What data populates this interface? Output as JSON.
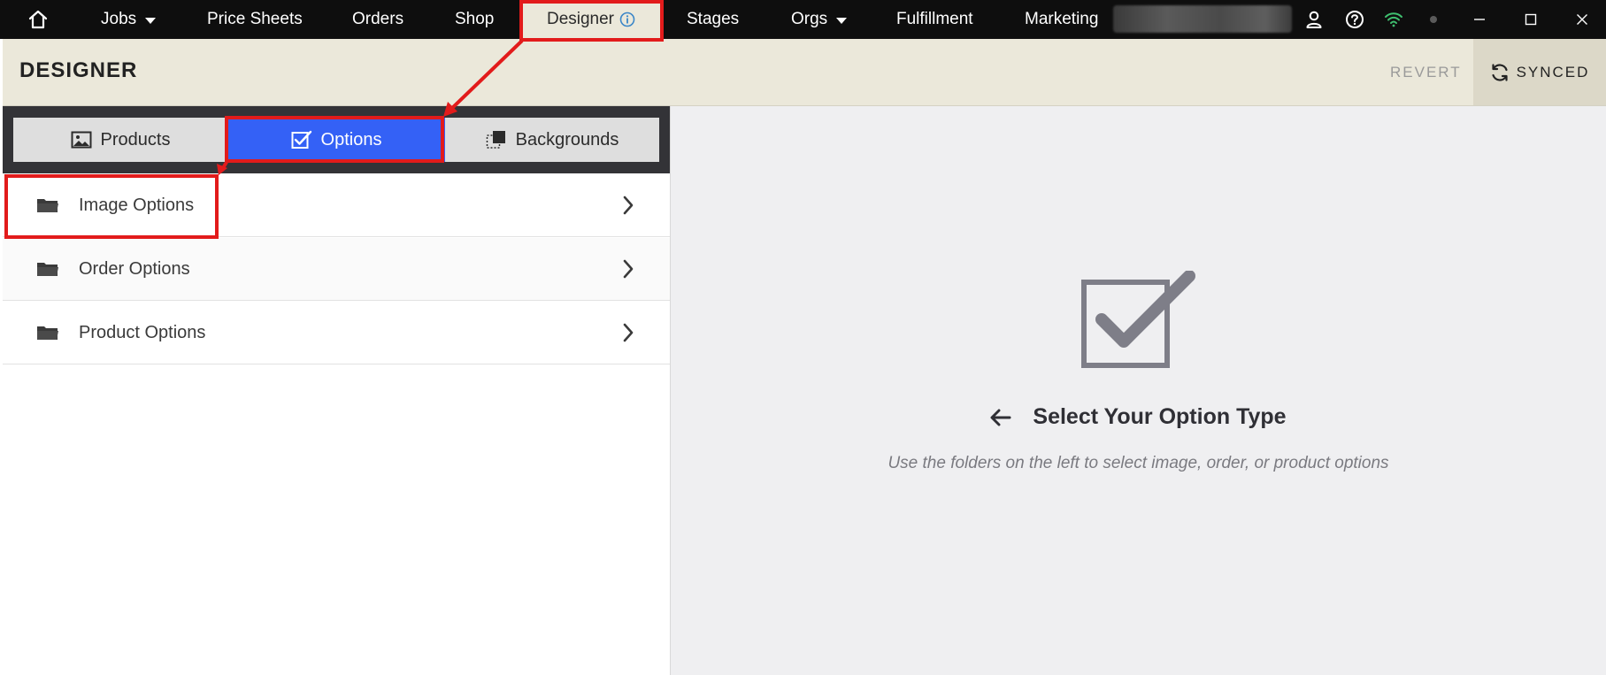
{
  "nav": {
    "home_icon": "home-icon",
    "jobs": "Jobs",
    "price_sheets": "Price Sheets",
    "orders": "Orders",
    "shop": "Shop",
    "designer": "Designer",
    "stages": "Stages",
    "orgs": "Orgs",
    "fulfillment": "Fulfillment",
    "marketing": "Marketing"
  },
  "window_controls": [
    "user-icon",
    "help-icon",
    "wifi-icon",
    "status-dot-icon",
    "minimize-icon",
    "maximize-icon",
    "close-icon"
  ],
  "header": {
    "title": "DESIGNER",
    "revert_label": "REVERT",
    "synced_label": "SYNCED"
  },
  "tabs": [
    {
      "label": "Products",
      "icon": "image-icon",
      "active": false
    },
    {
      "label": "Options",
      "icon": "checkbox-icon",
      "active": true
    },
    {
      "label": "Backgrounds",
      "icon": "background-icon",
      "active": false
    }
  ],
  "folders": [
    {
      "label": "Image Options"
    },
    {
      "label": "Order Options"
    },
    {
      "label": "Product Options"
    }
  ],
  "empty_state": {
    "title": "Select Your Option Type",
    "subtitle": "Use the folders on the left to select image, order, or product options"
  },
  "colors": {
    "nav_bg": "#0e0e0e",
    "header_bg": "#ebe8da",
    "active_tab": "#3461f6",
    "annotation": "#e21b1b",
    "right_bg": "#efeff1"
  }
}
